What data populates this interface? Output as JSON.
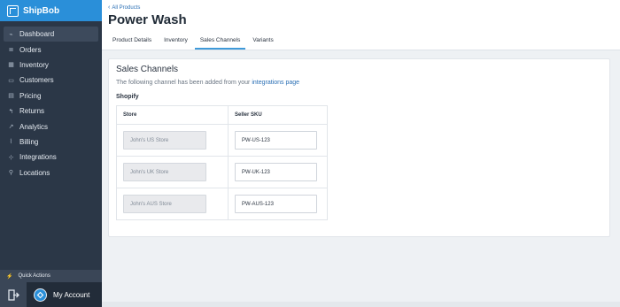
{
  "brand": {
    "name": "ShipBob"
  },
  "sidebar": {
    "items": [
      {
        "label": "Dashboard",
        "icon": "dashboard-icon",
        "glyph": "⌁",
        "active": true
      },
      {
        "label": "Orders",
        "icon": "orders-icon",
        "glyph": "≣"
      },
      {
        "label": "Inventory",
        "icon": "inventory-icon",
        "glyph": "▦"
      },
      {
        "label": "Customers",
        "icon": "customers-icon",
        "glyph": "▭"
      },
      {
        "label": "Pricing",
        "icon": "pricing-icon",
        "glyph": "▤"
      },
      {
        "label": "Returns",
        "icon": "returns-icon",
        "glyph": "↰"
      },
      {
        "label": "Analytics",
        "icon": "analytics-icon",
        "glyph": "↗"
      },
      {
        "label": "Billing",
        "icon": "billing-icon",
        "glyph": "⌇"
      },
      {
        "label": "Integrations",
        "icon": "integrations-icon",
        "glyph": "⊹"
      },
      {
        "label": "Locations",
        "icon": "location-pin-icon",
        "glyph": "⚲"
      }
    ],
    "quick_actions": "Quick Actions",
    "account": "My Account"
  },
  "header": {
    "back_link": "All Products",
    "title": "Power Wash"
  },
  "tabs": [
    {
      "label": "Product Details",
      "active": false
    },
    {
      "label": "Inventory",
      "active": false
    },
    {
      "label": "Sales Channels",
      "active": true
    },
    {
      "label": "Variants",
      "active": false
    }
  ],
  "card": {
    "title": "Sales Channels",
    "subtitle_prefix": "The following channel has been added from your ",
    "subtitle_link": "integrations page",
    "group": "Shopify",
    "columns": [
      "Store",
      "Seller SKU"
    ],
    "rows": [
      {
        "store": "John's US Store",
        "sku": "PW-US-123"
      },
      {
        "store": "John's UK Store",
        "sku": "PW-UK-123"
      },
      {
        "store": "John's AUS Store",
        "sku": "PW-AUS-123"
      }
    ]
  },
  "colors": {
    "brand": "#2a8fd9",
    "sidebar": "#2b3747",
    "link": "#2a6fb5",
    "active_tab": "#3f9ad9"
  }
}
